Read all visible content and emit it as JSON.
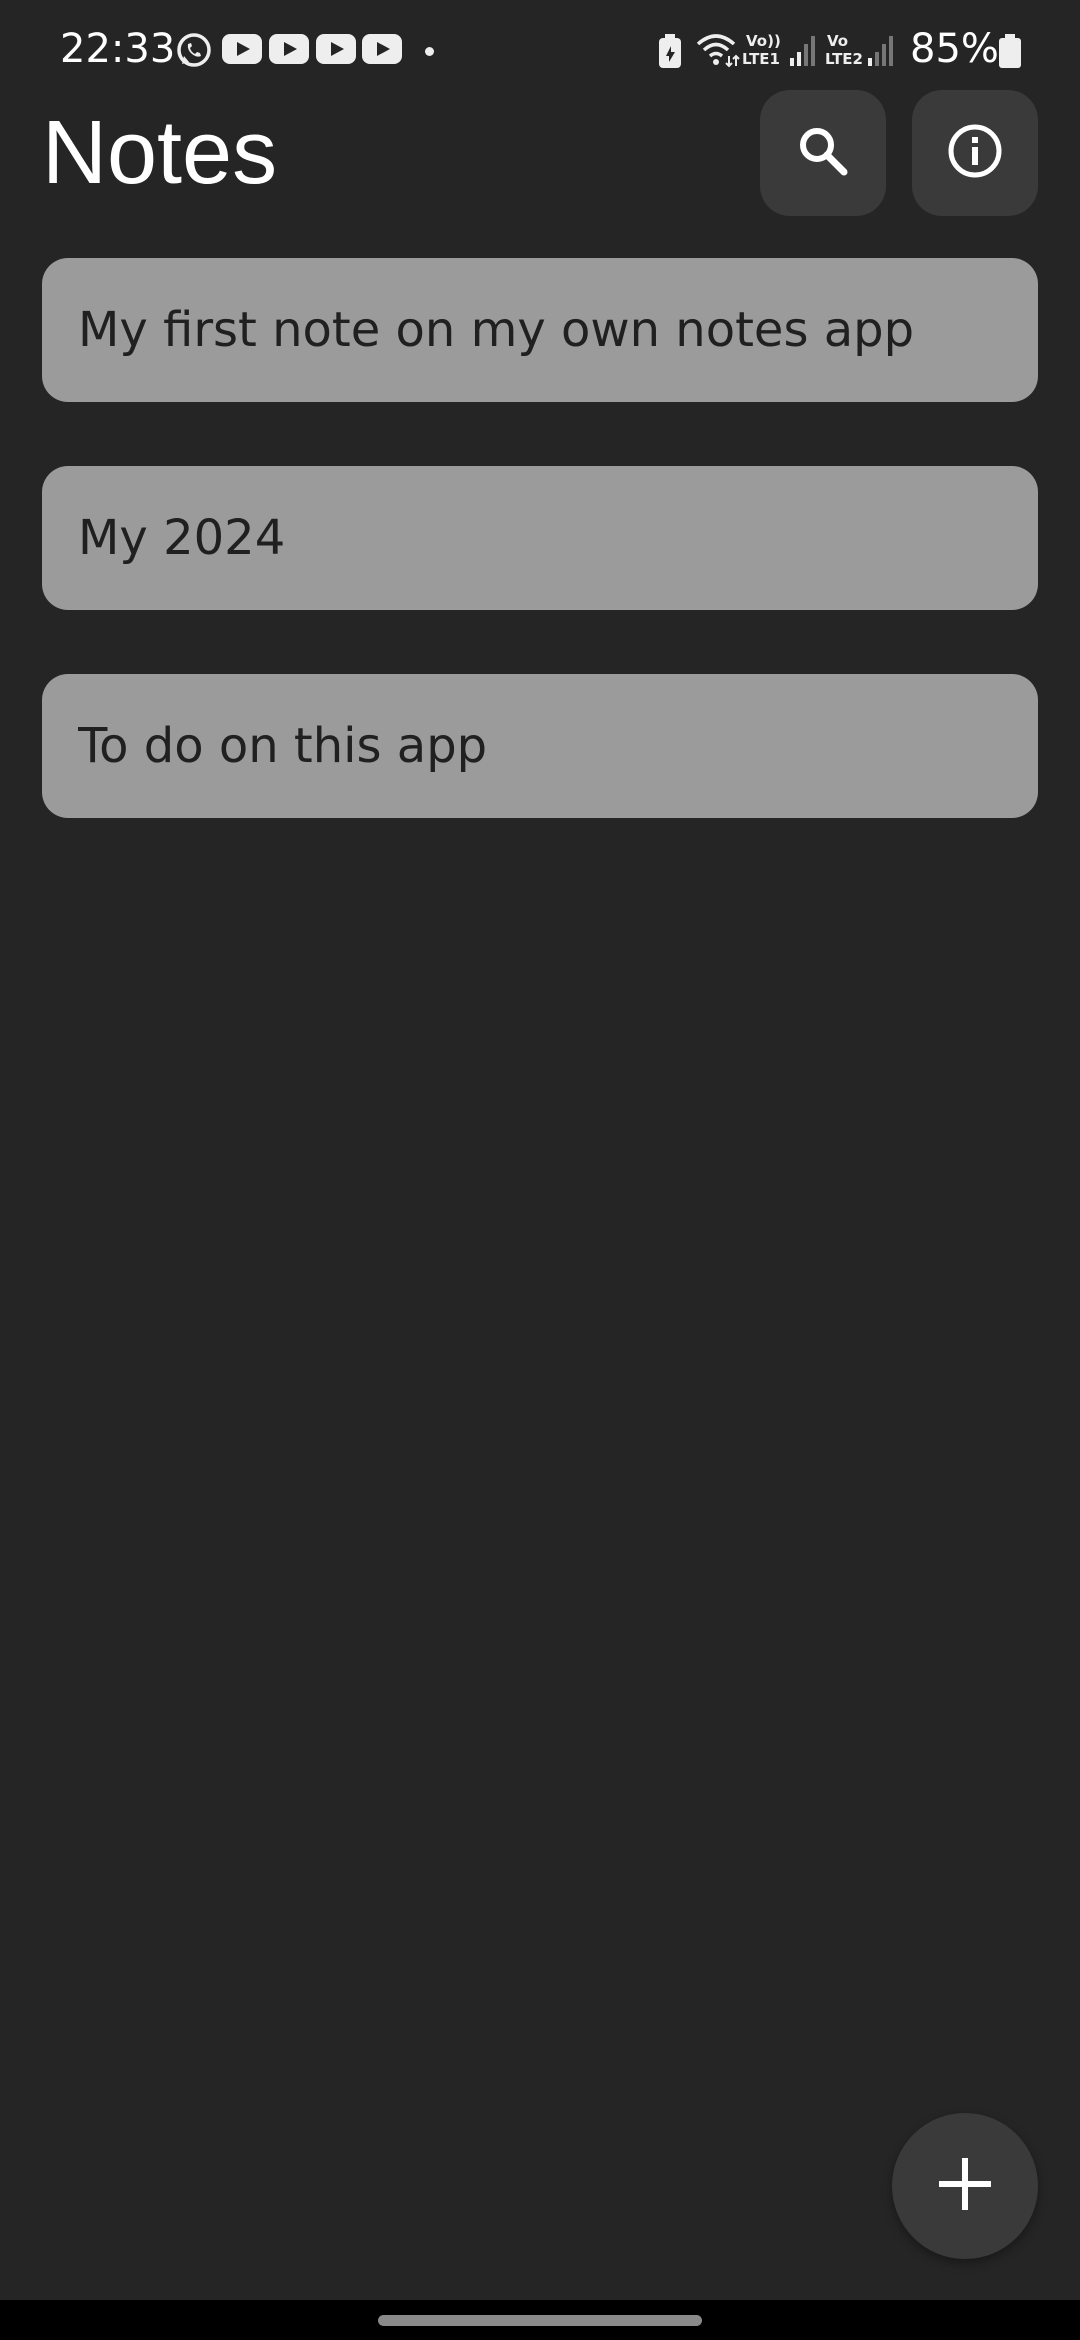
{
  "status_bar": {
    "time": "22:33",
    "battery_percent": "85%",
    "notification_icons": [
      "whatsapp-icon",
      "youtube-icon",
      "youtube-icon",
      "youtube-icon",
      "youtube-icon"
    ],
    "sim1_label_top": "Vo))",
    "sim1_label_bottom": "LTE1",
    "sim2_label_top": "Vo",
    "sim2_label_bottom": "LTE2"
  },
  "header": {
    "title": "Notes",
    "search_icon": "search-icon",
    "info_icon": "info-icon"
  },
  "notes": [
    {
      "title": "My first note on my own notes app"
    },
    {
      "title": "My 2024"
    },
    {
      "title": "To do on this app"
    }
  ],
  "fab": {
    "icon": "plus-icon"
  },
  "colors": {
    "background": "#252525",
    "note_card": "#9b9b9b",
    "button": "#3a3a3a",
    "text_dark": "#202020",
    "text_light": "#ffffff"
  }
}
